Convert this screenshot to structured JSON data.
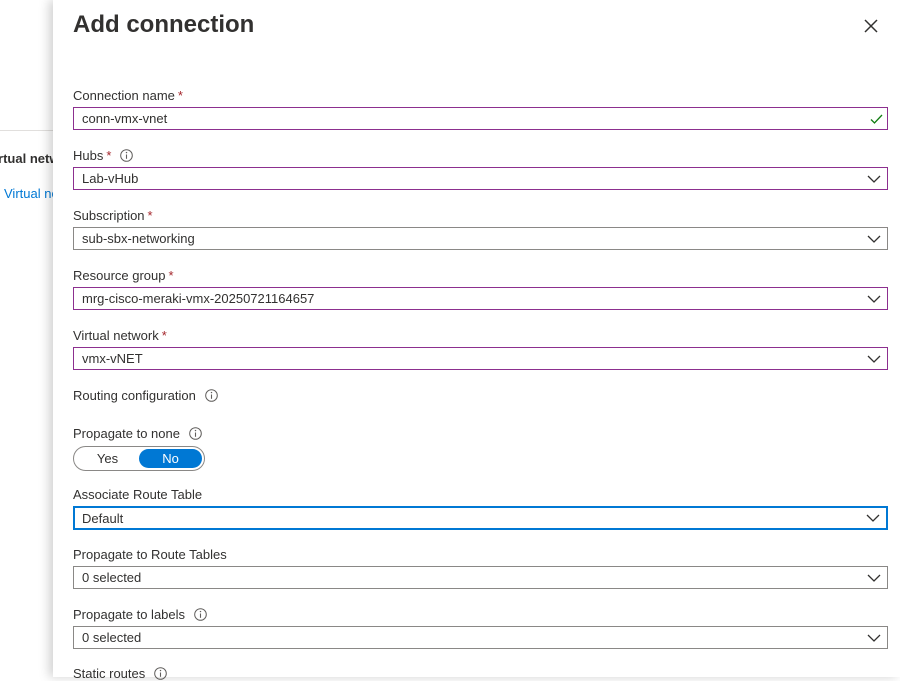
{
  "background": {
    "column_header": "Virtual network",
    "row_link": "Virtual network"
  },
  "blade": {
    "title": "Add connection",
    "fields": {
      "connection_name": {
        "label": "Connection name",
        "required": "*",
        "value": "conn-vmx-vnet"
      },
      "hubs": {
        "label": "Hubs",
        "required": "*",
        "value": "Lab-vHub"
      },
      "subscription": {
        "label": "Subscription",
        "required": "*",
        "value": "sub-sbx-networking"
      },
      "resource_group": {
        "label": "Resource group",
        "required": "*",
        "value": "mrg-cisco-meraki-vmx-20250721164657"
      },
      "virtual_network": {
        "label": "Virtual network",
        "required": "*",
        "value": "vmx-vNET"
      }
    },
    "routing": {
      "section_label": "Routing configuration",
      "propagate_none": {
        "label": "Propagate to none",
        "yes_label": "Yes",
        "no_label": "No",
        "selected": "No"
      },
      "associate_route_table": {
        "label": "Associate Route Table",
        "value": "Default"
      },
      "propagate_route_tables": {
        "label": "Propagate to Route Tables",
        "value": "0 selected"
      },
      "propagate_labels": {
        "label": "Propagate to labels",
        "value": "0 selected"
      },
      "static_routes": {
        "label": "Static routes"
      }
    }
  },
  "colors": {
    "accent": "#0078d4",
    "required": "#a4262c",
    "valid_border": "#8c2f8f",
    "valid_check": "#107c10"
  }
}
